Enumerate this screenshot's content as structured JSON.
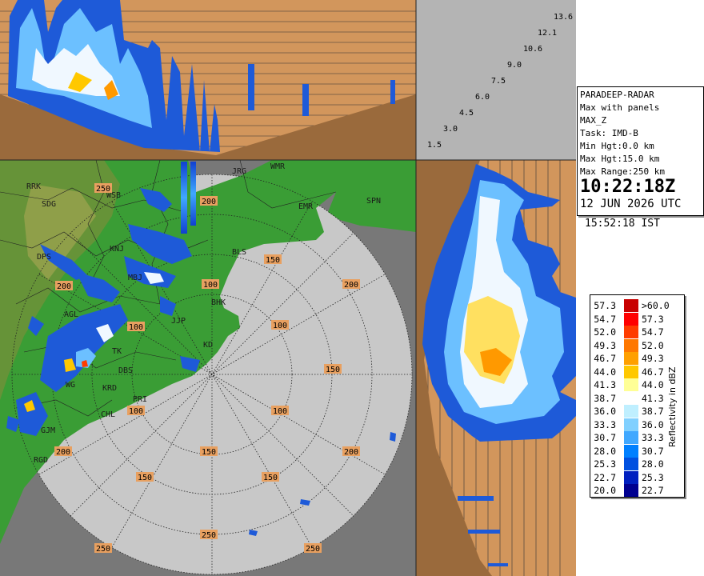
{
  "info": {
    "radar": "PARADEEP-RADAR",
    "product": "Max with panels",
    "type": "MAX_Z",
    "task": "Task: IMD-B",
    "min_hgt": "Min Hgt:0.0 km",
    "max_hgt": "Max Hgt:15.0 km",
    "max_range": "Max Range:250 km",
    "time_utc": "10:22:18Z",
    "date_utc": "12 JUN 2026 UTC",
    "time_ist": "15:52:18 IST"
  },
  "height_scale": [
    "13.6",
    "12.1",
    "10.6",
    "9.0",
    "7.5",
    "6.0",
    "4.5",
    "3.0",
    "1.5"
  ],
  "range_labels": [
    "100",
    "150",
    "200",
    "250",
    "100",
    "150",
    "200",
    "250",
    "100",
    "150",
    "200",
    "250",
    "100",
    "150",
    "200",
    "250",
    "200",
    "150",
    "100"
  ],
  "places": [
    "RRK",
    "SDG",
    "WSB",
    "JRG",
    "WMR",
    "EMR",
    "SPN",
    "KNJ",
    "BLS",
    "DPS",
    "MBJ",
    "BHK",
    "JJP",
    "AGL",
    "KD",
    "TK",
    "DBS",
    "WG",
    "KRD",
    "PRI",
    "CHL",
    "GJM",
    "RGD"
  ],
  "legend": {
    "title": "Reflectivity in dBZ",
    "rows": [
      {
        "lo": "57.3",
        "hi": ">60.0",
        "color": "#c80000"
      },
      {
        "lo": "54.7",
        "hi": "57.3",
        "color": "#ff0000"
      },
      {
        "lo": "52.0",
        "hi": "54.7",
        "color": "#ff3c00"
      },
      {
        "lo": "49.3",
        "hi": "52.0",
        "color": "#ff7800"
      },
      {
        "lo": "46.7",
        "hi": "49.3",
        "color": "#ffa000"
      },
      {
        "lo": "44.0",
        "hi": "46.7",
        "color": "#ffc800"
      },
      {
        "lo": "41.3",
        "hi": "44.0",
        "color": "#ffff96"
      },
      {
        "lo": "38.7",
        "hi": "41.3",
        "color": "#ffffff"
      },
      {
        "lo": "36.0",
        "hi": "38.7",
        "color": "#bfefff"
      },
      {
        "lo": "33.3",
        "hi": "36.0",
        "color": "#80d0ff"
      },
      {
        "lo": "30.7",
        "hi": "33.3",
        "color": "#40a8ff"
      },
      {
        "lo": "28.0",
        "hi": "30.7",
        "color": "#0080ff"
      },
      {
        "lo": "25.3",
        "hi": "28.0",
        "color": "#0050e0"
      },
      {
        "lo": "22.7",
        "hi": "25.3",
        "color": "#0020c0"
      },
      {
        "lo": "20.0",
        "hi": "22.7",
        "color": "#000090"
      }
    ]
  }
}
